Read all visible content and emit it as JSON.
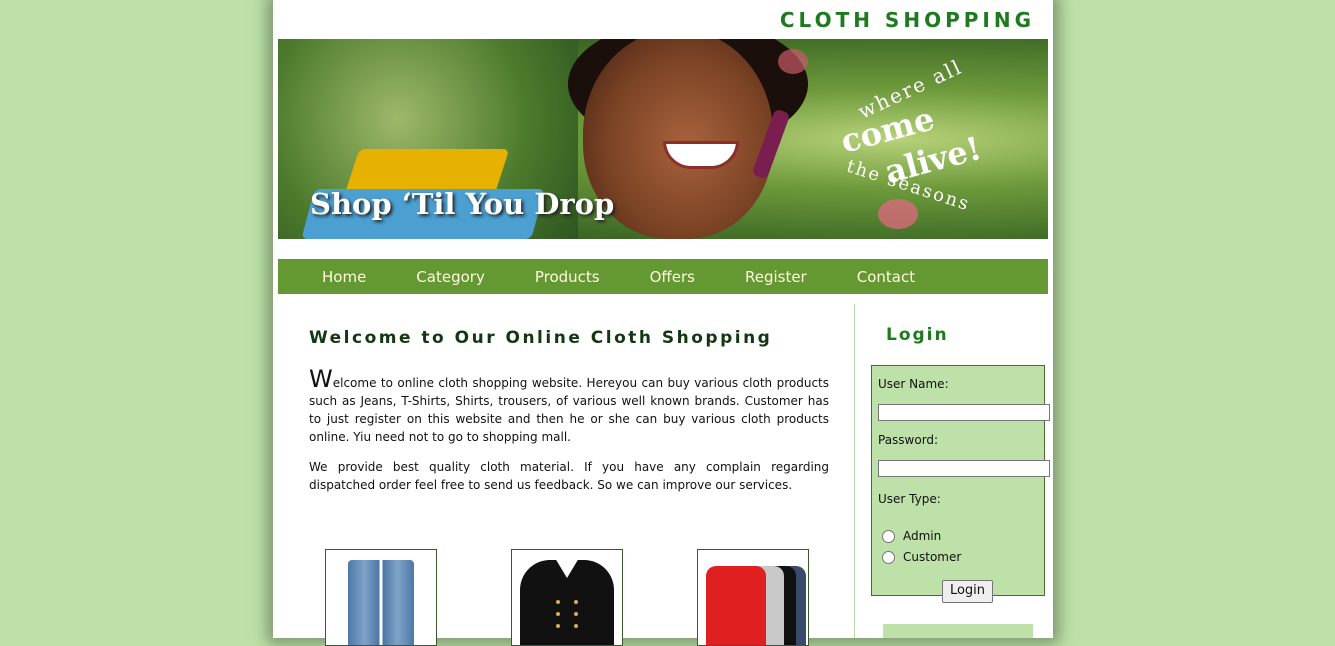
{
  "site": {
    "title": "CLOTH SHOPPING"
  },
  "banner": {
    "slogan": "Shop ‘Til You Drop",
    "badge_top": "where all",
    "badge_main_1": "come",
    "badge_main_2": "alive!",
    "badge_bottom": "the seasons"
  },
  "nav": {
    "items": [
      {
        "label": "Home"
      },
      {
        "label": "Category"
      },
      {
        "label": "Products"
      },
      {
        "label": "Offers"
      },
      {
        "label": "Register"
      },
      {
        "label": "Contact"
      }
    ]
  },
  "main": {
    "title": "Welcome to Our Online Cloth Shopping",
    "para1_dropcap": "W",
    "para1_rest": "elcome to online cloth shopping website. Hereyou can buy various cloth products such as Jeans, T-Shirts, Shirts, trousers, of various well known brands. Customer has to just register on this website and then he or she can buy various cloth products online. Yiu need not to go to shopping mall.",
    "para2": "We provide best quality cloth material. If you have any complain regarding dispatched order feel free to send us feedback. So we can improve our services."
  },
  "products": [
    {
      "icon": "jeans-icon"
    },
    {
      "icon": "jacket-icon"
    },
    {
      "icon": "tshirts-icon"
    }
  ],
  "login": {
    "title": "Login",
    "username_label": "User Name:",
    "username_value": "",
    "password_label": "Password:",
    "password_value": "",
    "usertype_label": "User Type:",
    "options": [
      {
        "label": "Admin",
        "selected": false
      },
      {
        "label": "Customer",
        "selected": false
      }
    ],
    "button_label": "Login"
  },
  "colors": {
    "background": "#bde1a8",
    "nav_bar": "#639832",
    "nav_text": "#fffbdc",
    "title_green": "#1e7a1e",
    "heading_dark": "#123812"
  }
}
